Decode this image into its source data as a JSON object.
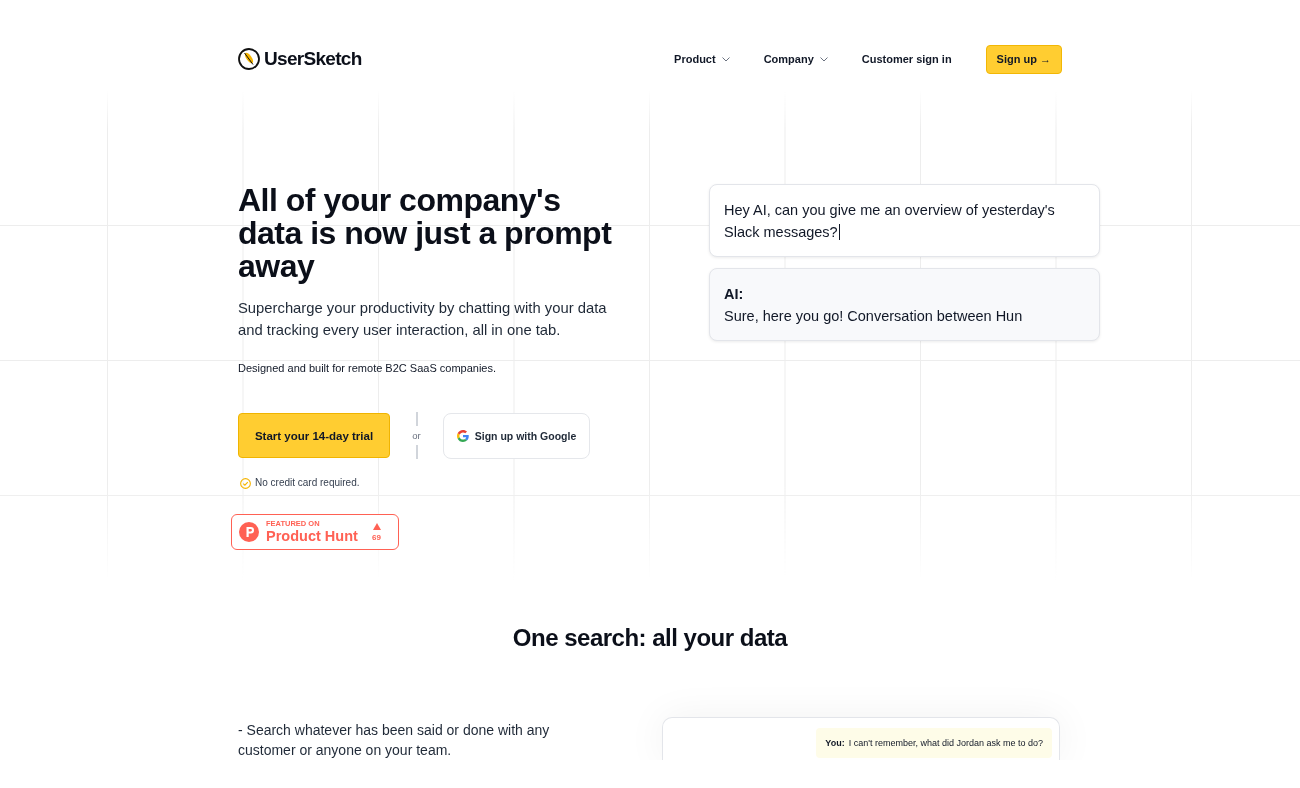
{
  "header": {
    "logo": {
      "text": "UserSketch"
    },
    "nav": [
      {
        "label": "Product",
        "kind": "dropdown"
      },
      {
        "label": "Company",
        "kind": "dropdown"
      },
      {
        "label": "Customer sign in",
        "kind": "link"
      }
    ],
    "cta": {
      "label": "Sign up →"
    }
  },
  "hero": {
    "title": "All of your company's data is now just a prompt away",
    "subtitle": "Supercharge your productivity by chatting with your data and tracking every user interaction, all in one tab.",
    "tagline": "Designed and built for remote B2C SaaS companies.",
    "primary_button": "Start your 14-day trial",
    "separator": "or",
    "google_button": "Sign up with Google",
    "note": "No credit card required.",
    "badge": {
      "overline": "FEATURED ON",
      "name": "Product Hunt",
      "votes": "69"
    },
    "chat": [
      {
        "kind": "prompt",
        "text": "Hey AI, can you give me an overview of yesterday's Slack messages?",
        "cursor": true
      },
      {
        "kind": "answer",
        "speaker": "AI:",
        "text": "Sure, here you go! Conversation between Hun"
      }
    ]
  },
  "features": {
    "title": "One search: all your data",
    "points": [
      "- Search whatever has been said or done with any customer or anyone on your team."
    ],
    "demo": {
      "messages": [
        {
          "speaker": "You:",
          "text": "I can't remember, what did Jordan ask me to do?"
        }
      ]
    }
  }
}
